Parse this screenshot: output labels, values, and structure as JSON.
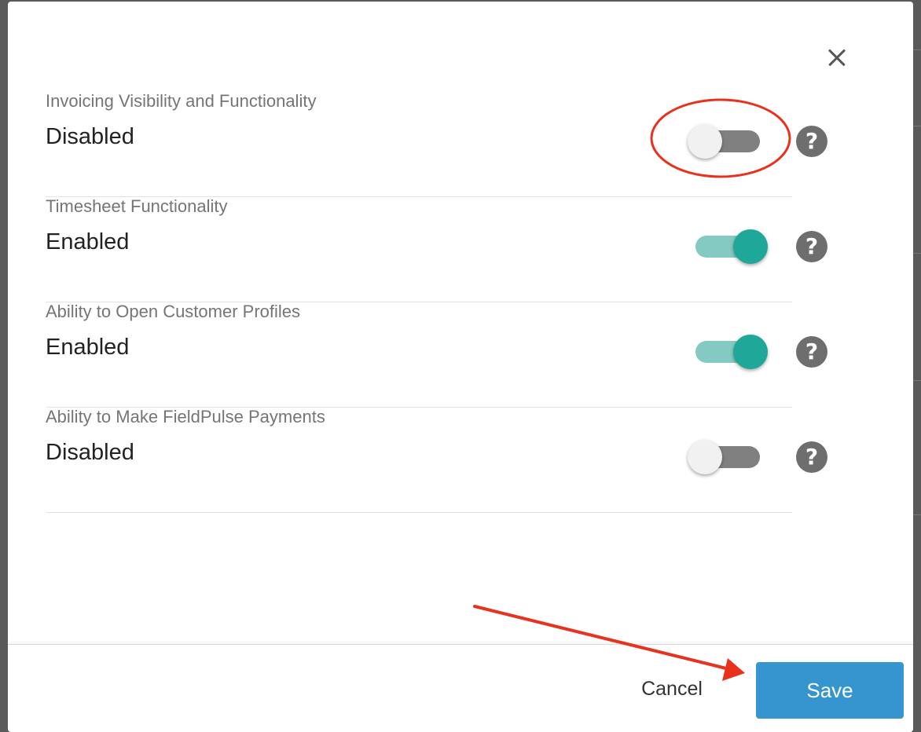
{
  "dialog": {
    "settings": [
      {
        "title": "Invoicing Visibility and Functionality",
        "status": "Disabled",
        "enabled": false,
        "help_icon": "?"
      },
      {
        "title": "Timesheet Functionality",
        "status": "Enabled",
        "enabled": true,
        "help_icon": "?"
      },
      {
        "title": "Ability to Open Customer Profiles",
        "status": "Enabled",
        "enabled": true,
        "help_icon": "?"
      },
      {
        "title": "Ability to Make FieldPulse Payments",
        "status": "Disabled",
        "enabled": false,
        "help_icon": "?"
      }
    ],
    "close_icon": "close-icon"
  },
  "footer": {
    "cancel_label": "Cancel",
    "save_label": "Save"
  },
  "colors": {
    "toggle_on_thumb": "#1fa79a",
    "toggle_on_track": "#84cac3",
    "toggle_off_track": "#808080",
    "save_button": "#3596cf",
    "annotation_red": "#e8321e"
  },
  "annotations": {
    "circle_highlight": "red-ellipse-around-first-toggle",
    "arrow": "red-arrow-pointing-to-save-button"
  }
}
